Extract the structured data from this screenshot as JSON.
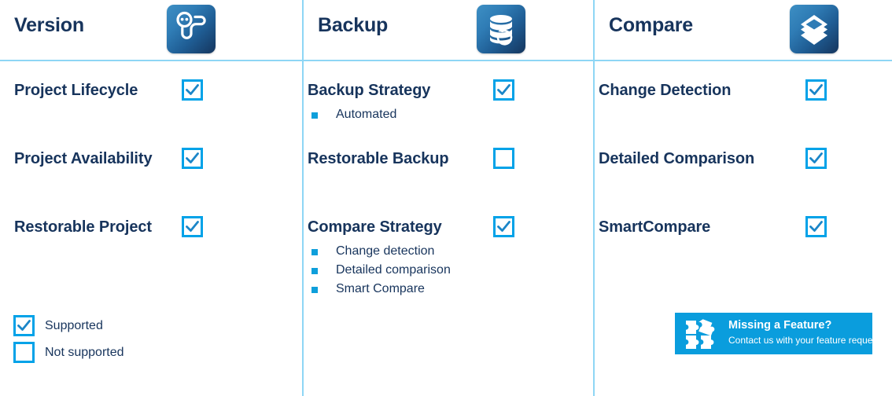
{
  "colors": {
    "heading_navy": "#17345c",
    "accent_cyan": "#00a2e8",
    "check_blue": "#1b86c8",
    "divider_blue": "#8ed6f5",
    "bullet_blue": "#0e9fdb",
    "banner_bg": "#0a9ddd",
    "icon_gradient_start": "#3d8fc4",
    "icon_gradient_end": "#15355d"
  },
  "columns": [
    {
      "title": "Version",
      "icon": "version-graph-icon",
      "features": [
        {
          "label": "Project Lifecycle",
          "supported": true,
          "subitems": []
        },
        {
          "label": "Project Availability",
          "supported": true,
          "subitems": []
        },
        {
          "label": "Restorable Project",
          "supported": true,
          "subitems": []
        }
      ]
    },
    {
      "title": "Backup",
      "icon": "database-restore-icon",
      "features": [
        {
          "label": "Backup Strategy",
          "supported": true,
          "subitems": [
            "Automated"
          ]
        },
        {
          "label": "Restorable Backup",
          "supported": false,
          "subitems": []
        },
        {
          "label": "Compare Strategy",
          "supported": true,
          "subitems": [
            "Change detection",
            "Detailed comparison",
            "Smart Compare"
          ]
        }
      ]
    },
    {
      "title": "Compare",
      "icon": "layers-stack-icon",
      "features": [
        {
          "label": "Change Detection",
          "supported": true,
          "subitems": []
        },
        {
          "label": "Detailed Comparison",
          "supported": true,
          "subitems": []
        },
        {
          "label": "SmartCompare",
          "supported": true,
          "subitems": []
        }
      ]
    }
  ],
  "legend": {
    "supported_label": "Supported",
    "not_supported_label": "Not supported"
  },
  "banner": {
    "icon": "puzzle-piece-icon",
    "title": "Missing a Feature?",
    "subtitle": "Contact us with your feature request!"
  }
}
